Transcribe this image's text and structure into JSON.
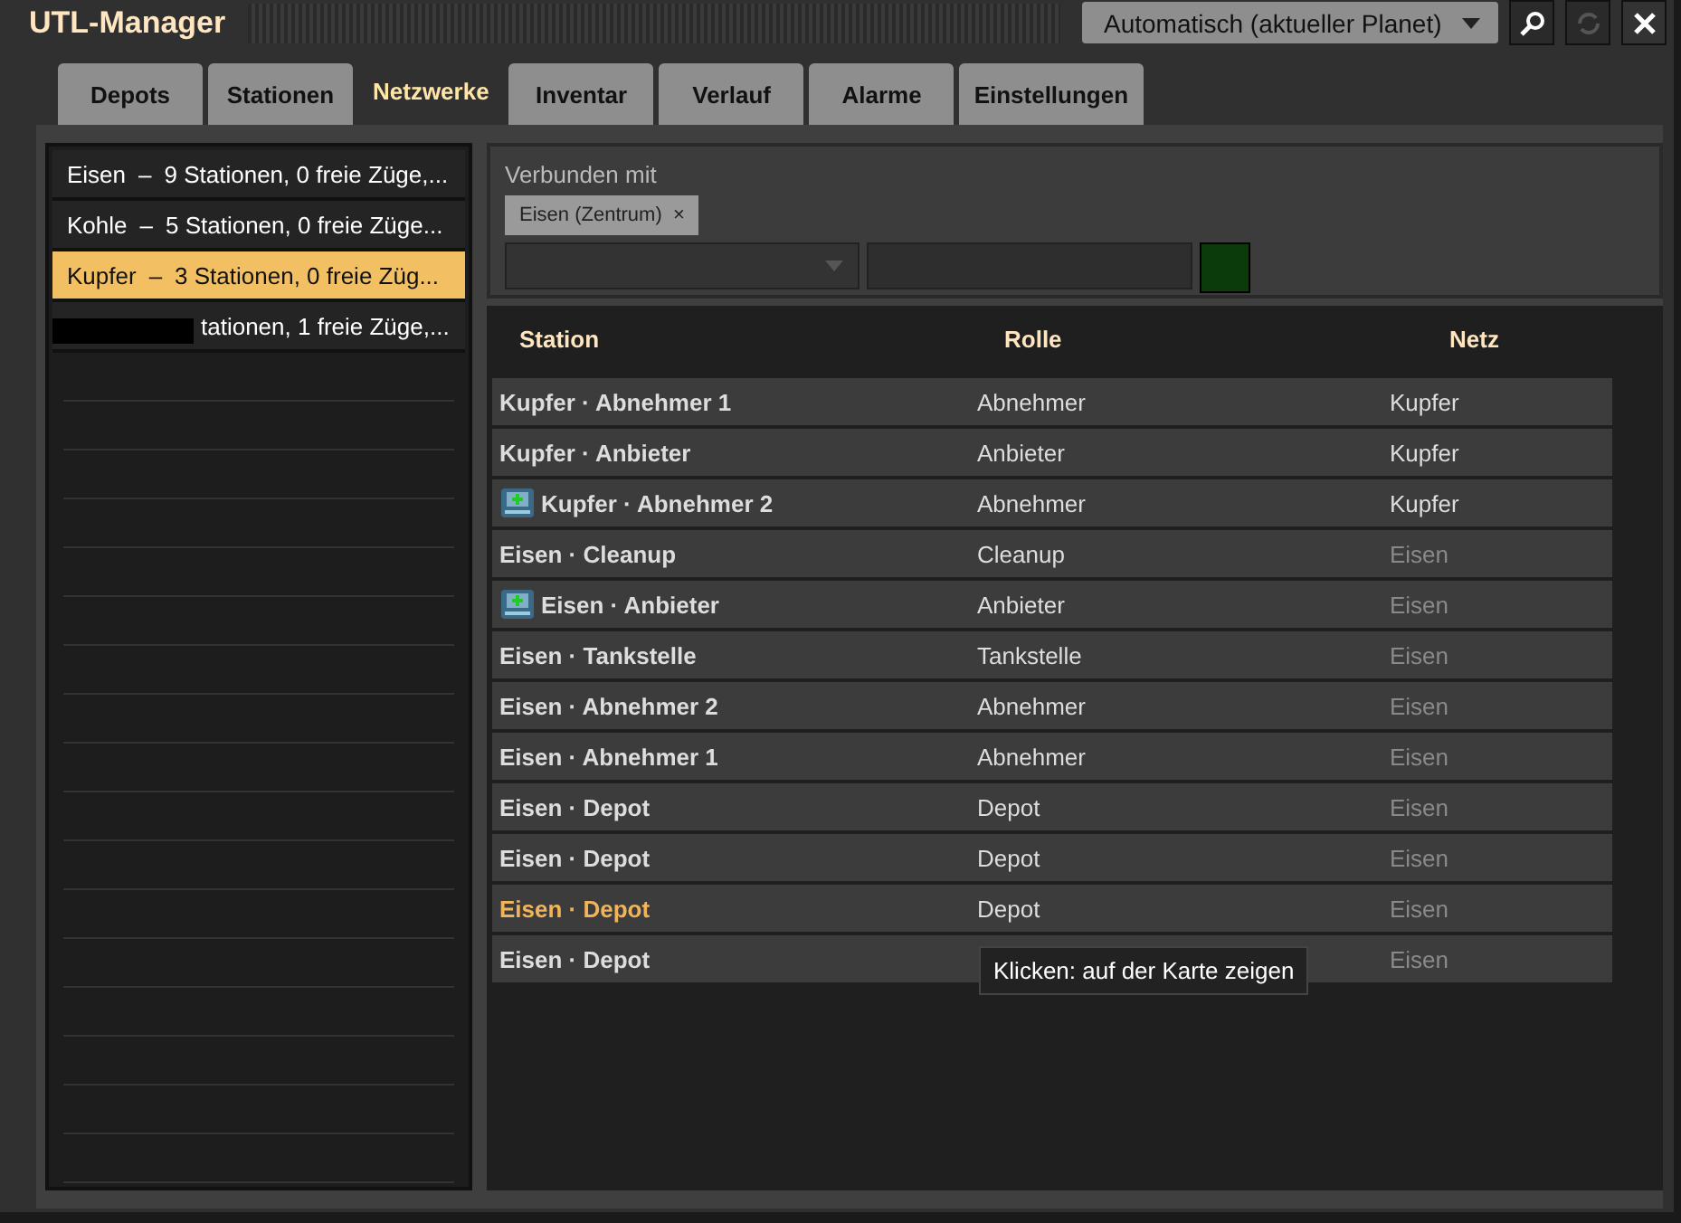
{
  "window": {
    "title": "UTL-Manager"
  },
  "surface_dropdown": {
    "value": "Automatisch (aktueller Planet)"
  },
  "tabs": [
    {
      "label": "Depots",
      "selected": false
    },
    {
      "label": "Stationen",
      "selected": false
    },
    {
      "label": "Netzwerke",
      "selected": true
    },
    {
      "label": "Inventar",
      "selected": false
    },
    {
      "label": "Verlauf",
      "selected": false
    },
    {
      "label": "Alarme",
      "selected": false
    },
    {
      "label": "Einstellungen",
      "selected": false
    }
  ],
  "networks": [
    {
      "name": "Eisen",
      "separator": "–",
      "summary": "9 Stationen, 0 freie Züge,...",
      "selected": false,
      "redacted": false
    },
    {
      "name": "Kohle",
      "separator": "–",
      "summary": "5 Stationen, 0 freie Züge...",
      "selected": false,
      "redacted": false
    },
    {
      "name": "Kupfer",
      "separator": "–",
      "summary": "3 Stationen, 0 freie Züg...",
      "selected": true,
      "redacted": false
    },
    {
      "summary": "tationen, 1 freie Züge,...",
      "selected": false,
      "redacted": true
    }
  ],
  "connections": {
    "label": "Verbunden mit",
    "chips": [
      {
        "label": "Eisen (Zentrum)",
        "remove": "×"
      }
    ]
  },
  "table": {
    "columns": [
      "Station",
      "Rolle",
      "Netz"
    ],
    "rows": [
      {
        "station": "Kupfer · Abnehmer 1",
        "role": "Abnehmer",
        "network": "Kupfer",
        "icon": false,
        "dimmed": false,
        "selected": false
      },
      {
        "station": "Kupfer · Anbieter",
        "role": "Anbieter",
        "network": "Kupfer",
        "icon": false,
        "dimmed": false,
        "selected": false
      },
      {
        "station": "Kupfer · Abnehmer 2",
        "role": "Abnehmer",
        "network": "Kupfer",
        "icon": true,
        "dimmed": false,
        "selected": false
      },
      {
        "station": "Eisen · Cleanup",
        "role": "Cleanup",
        "network": "Eisen",
        "icon": false,
        "dimmed": true,
        "selected": false
      },
      {
        "station": "Eisen · Anbieter",
        "role": "Anbieter",
        "network": "Eisen",
        "icon": true,
        "dimmed": true,
        "selected": false
      },
      {
        "station": "Eisen · Tankstelle",
        "role": "Tankstelle",
        "network": "Eisen",
        "icon": false,
        "dimmed": true,
        "selected": false
      },
      {
        "station": "Eisen · Abnehmer 2",
        "role": "Abnehmer",
        "network": "Eisen",
        "icon": false,
        "dimmed": true,
        "selected": false
      },
      {
        "station": "Eisen · Abnehmer 1",
        "role": "Abnehmer",
        "network": "Eisen",
        "icon": false,
        "dimmed": true,
        "selected": false
      },
      {
        "station": "Eisen · Depot",
        "role": "Depot",
        "network": "Eisen",
        "icon": false,
        "dimmed": true,
        "selected": false
      },
      {
        "station": "Eisen · Depot",
        "role": "Depot",
        "network": "Eisen",
        "icon": false,
        "dimmed": true,
        "selected": false
      },
      {
        "station": "Eisen · Depot",
        "role": "Depot",
        "network": "Eisen",
        "icon": false,
        "dimmed": true,
        "selected": true
      },
      {
        "station": "Eisen · Depot",
        "network": "Eisen",
        "icon": false,
        "dimmed": true,
        "selected": false
      }
    ]
  },
  "tooltip": {
    "text": "Klicken: auf der Karte zeigen"
  }
}
